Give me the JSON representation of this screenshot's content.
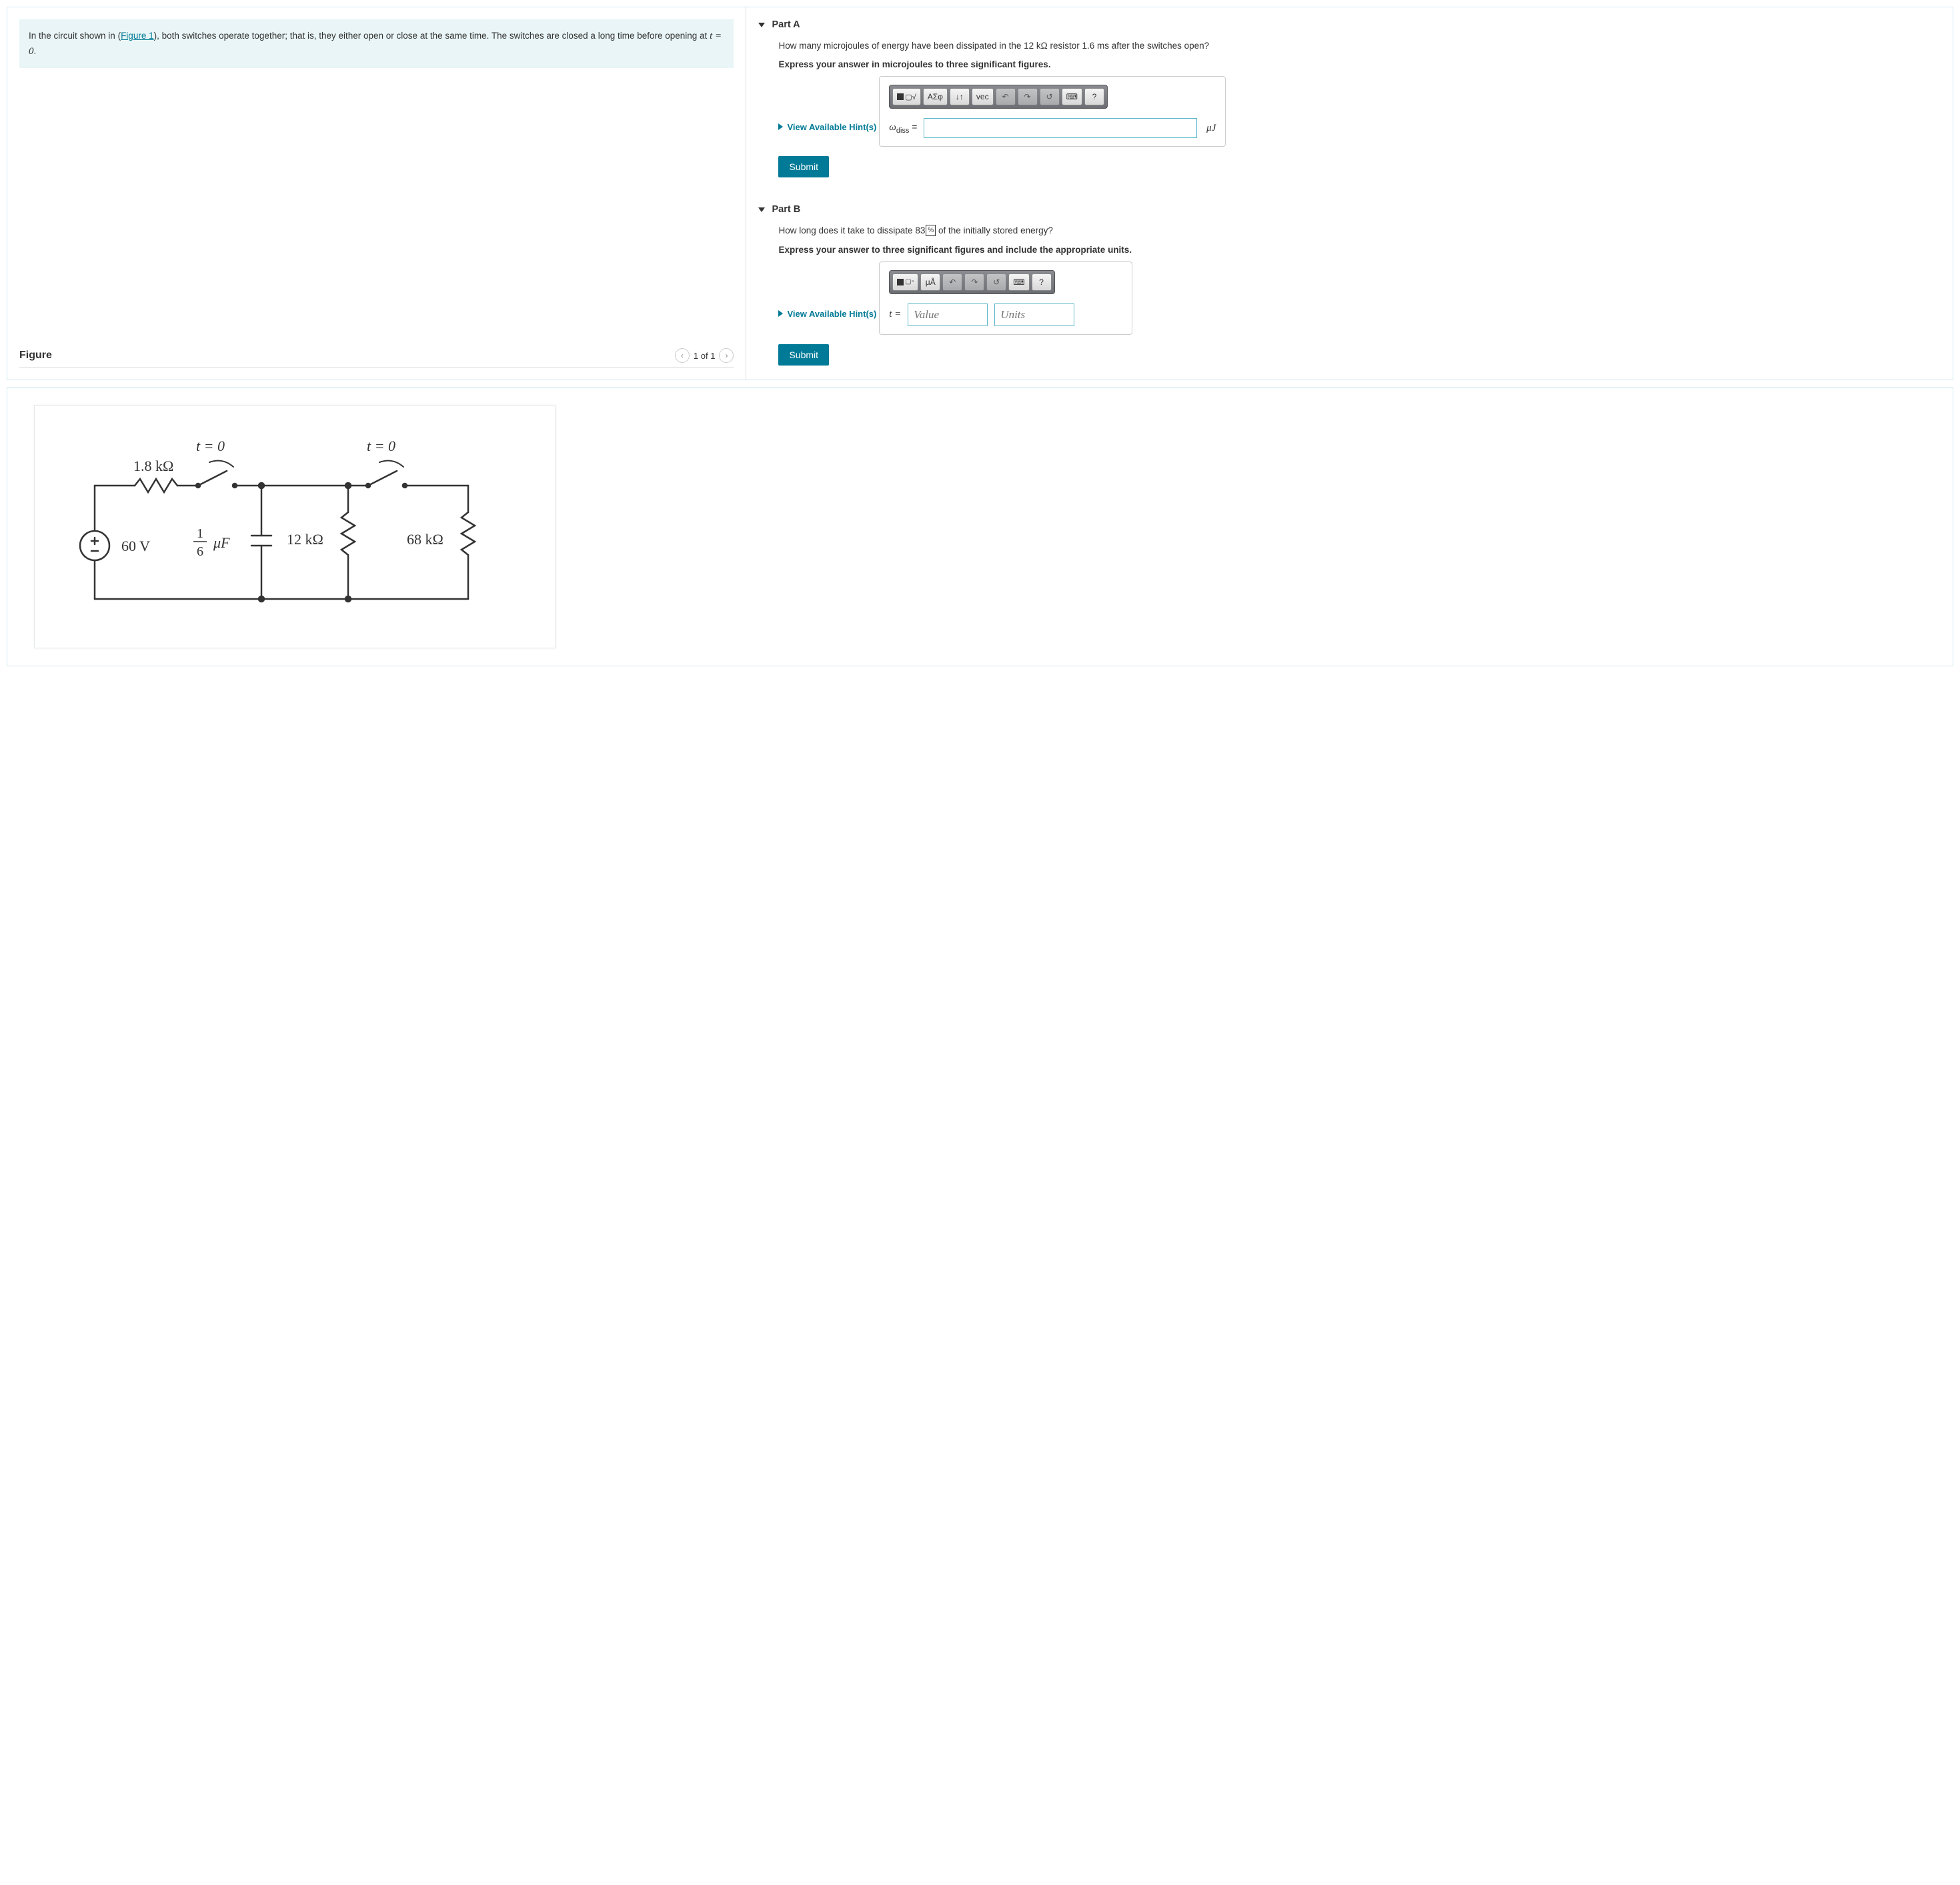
{
  "problem_statement": {
    "prefix": "In the circuit shown in (",
    "figlink": "Figure 1",
    "suffix": "), both switches operate together; that is, they either open or close at the same time. The switches are closed a long time before opening at ",
    "var": "t = 0",
    "end": "."
  },
  "figure_panel": {
    "title": "Figure",
    "pager": "1 of 1"
  },
  "partA": {
    "label": "Part A",
    "question": "How many microjoules of energy have been dissipated in the 12 kΩ resistor 1.6 ms after the switches open?",
    "instruction": "Express your answer in microjoules to three significant figures.",
    "hint": "View Available Hint(s)",
    "var_symbol_html": "ω",
    "var_sub": "diss",
    "eq": " = ",
    "unit": "μJ",
    "toolbar": {
      "tmpl": "▢√",
      "greek": "ΑΣφ",
      "sub": "↓↑",
      "vec": "vec",
      "undo": "↶",
      "redo": "↷",
      "reset": "↺",
      "kbd": "⌨",
      "help": "?"
    },
    "submit": "Submit"
  },
  "partB": {
    "label": "Part B",
    "question_pre": "How long does it take to dissipate 83",
    "question_pct": "%",
    "question_post": " of the initially stored energy?",
    "instruction": "Express your answer to three significant figures and include the appropriate units.",
    "hint": "View Available Hint(s)",
    "var_t": "t = ",
    "value_ph": "Value",
    "units_ph": "Units",
    "toolbar": {
      "tmpl": "▢▫",
      "ua": "μÅ",
      "undo": "↶",
      "redo": "↷",
      "reset": "↺",
      "kbd": "⌨",
      "help": "?"
    },
    "submit": "Submit"
  },
  "circuit": {
    "t0_a": "t = 0",
    "t0_b": "t = 0",
    "r1": "1.8 kΩ",
    "vs": "60 V",
    "c_frac_num": "1",
    "c_frac_den": "6",
    "c_unit": "μF",
    "r2": "12 kΩ",
    "r3": "68 kΩ"
  },
  "chart_data": {
    "type": "circuit-diagram",
    "components": [
      {
        "kind": "voltage_source",
        "value_V": 60
      },
      {
        "kind": "resistor",
        "label": "1.8 kΩ",
        "value_ohm": 1800
      },
      {
        "kind": "switch",
        "label": "t = 0",
        "state": "opens_at_t0"
      },
      {
        "kind": "capacitor",
        "label": "1/6 μF",
        "value_F": 1.6667e-07
      },
      {
        "kind": "resistor",
        "label": "12 kΩ",
        "value_ohm": 12000
      },
      {
        "kind": "switch",
        "label": "t = 0",
        "state": "opens_at_t0"
      },
      {
        "kind": "resistor",
        "label": "68 kΩ",
        "value_ohm": 68000
      }
    ],
    "topology": "Voltage source in series with 1.8 kΩ and first switch to node A; capacitor and 12 kΩ from node A to ground (parallel); second switch from node A to node B; 68 kΩ from node B to ground."
  }
}
